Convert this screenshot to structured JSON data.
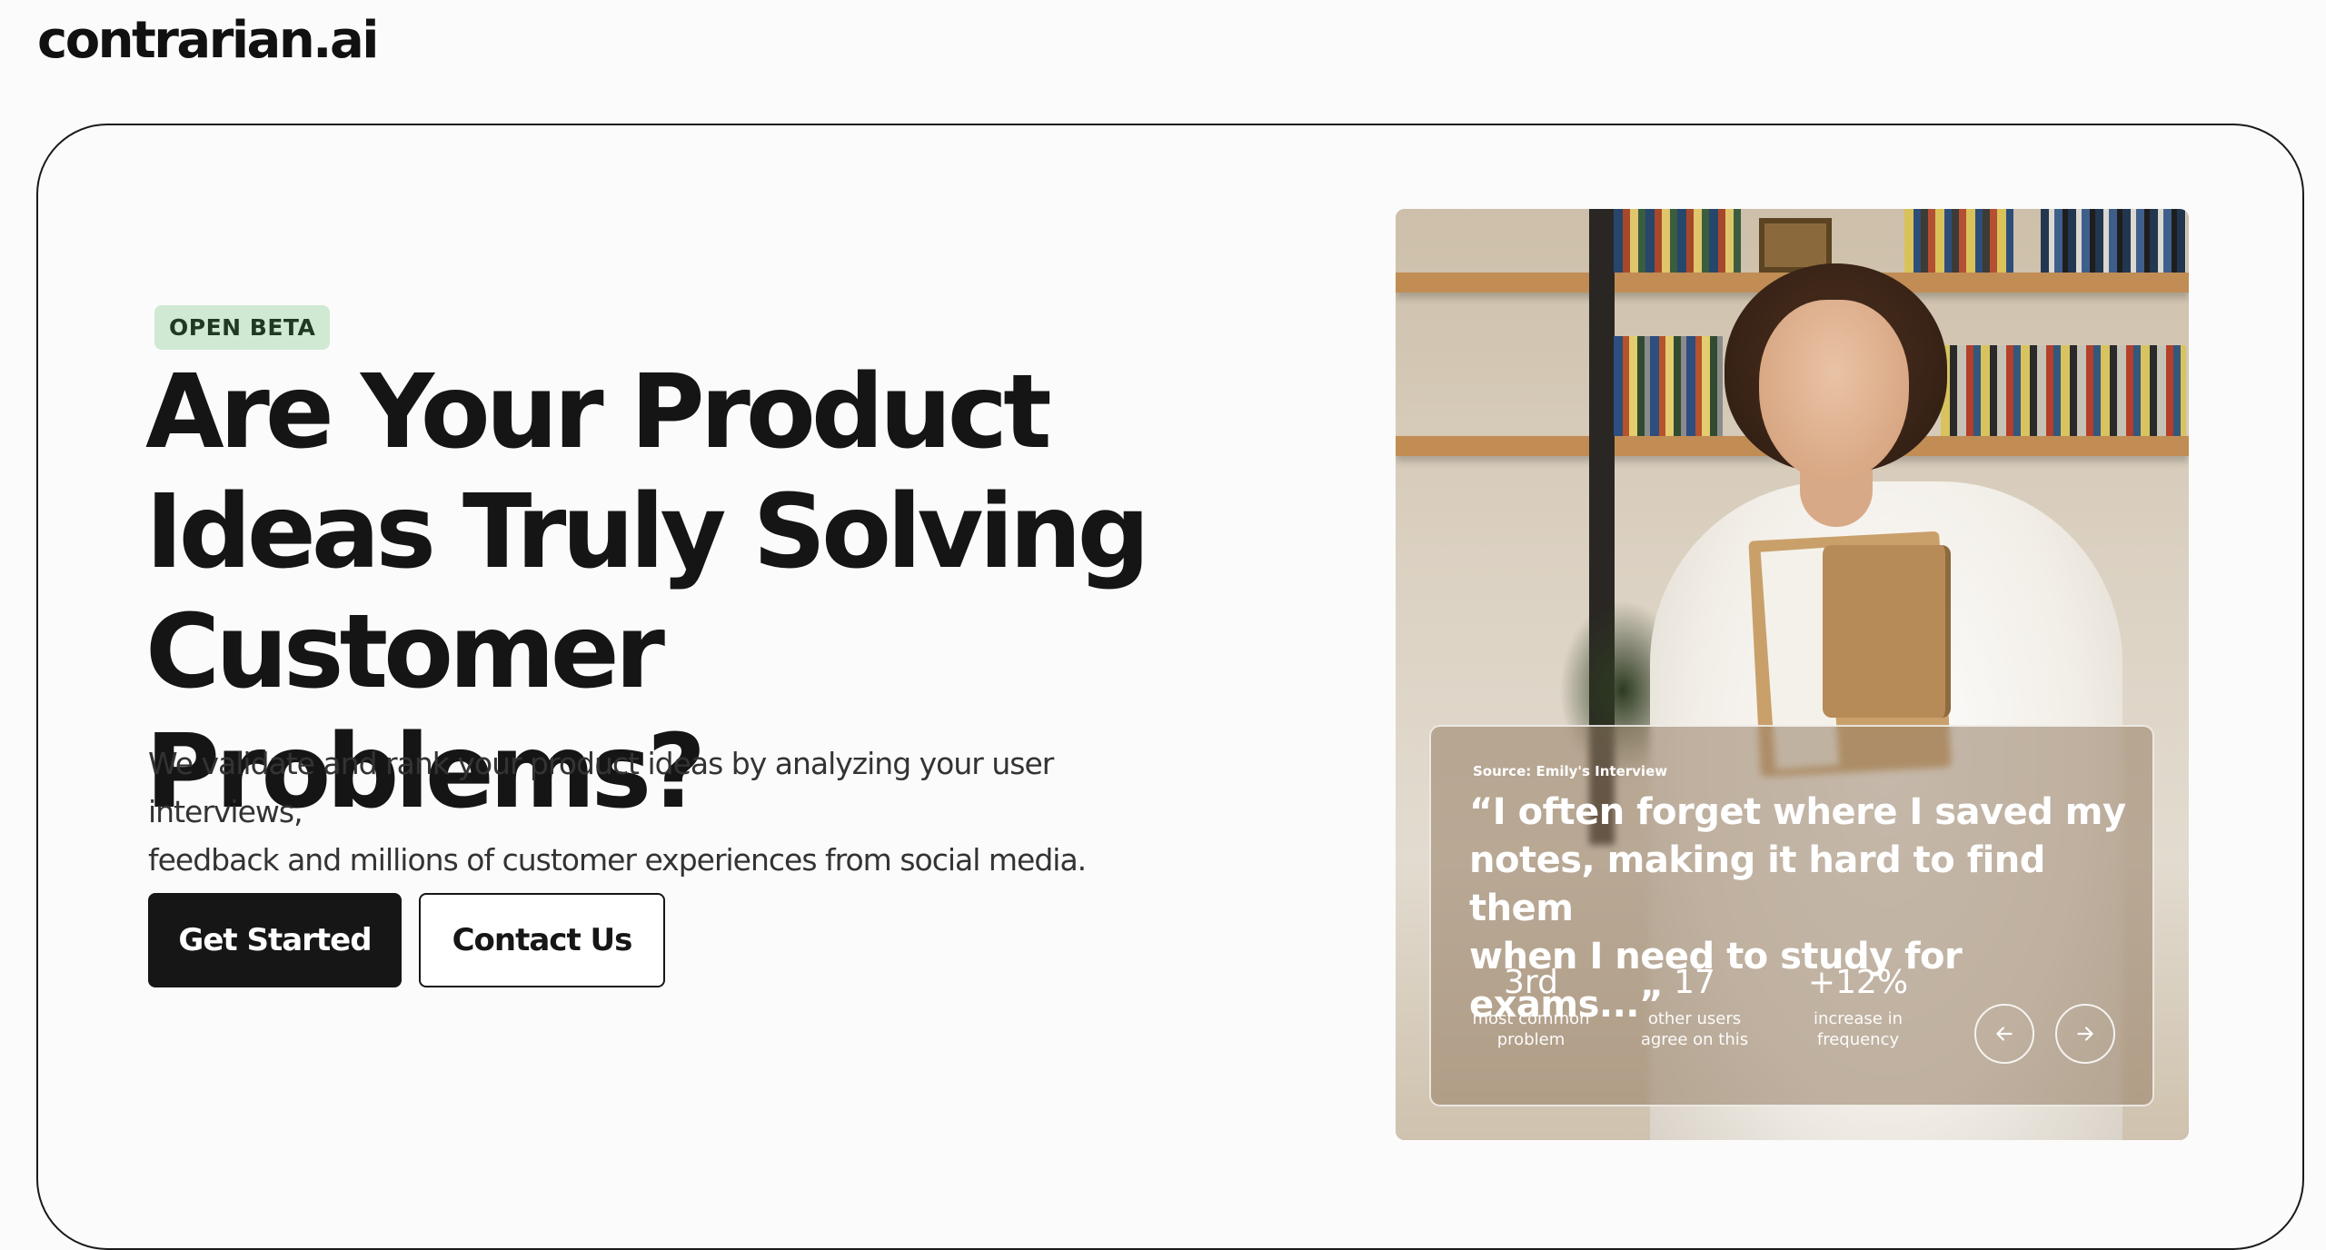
{
  "header": {
    "brand": "contrarian.ai"
  },
  "hero": {
    "badge": "OPEN BETA",
    "headline_lines": [
      "Are Your Product",
      "Ideas Truly Solving",
      "Customer Problems?"
    ],
    "subtitle_lines": [
      "We validate and rank your product ideas by analyzing your user interviews,",
      "feedback and millions of customer experiences from social media."
    ],
    "primary_button": "Get Started",
    "secondary_button": "Contact Us"
  },
  "testimonial": {
    "source": "Source: Emily's Interview",
    "quote_lines": [
      "“I often forget where I saved my",
      "notes, making it hard to find them",
      "when I need to study for exams...”"
    ],
    "stats": [
      {
        "value": "3rd",
        "label_lines": [
          "most common",
          "problem"
        ]
      },
      {
        "value": "17",
        "label_lines": [
          "other users",
          "agree on this"
        ]
      },
      {
        "value": "+12%",
        "label_lines": [
          "increase in",
          "frequency"
        ]
      }
    ],
    "prev_icon": "arrow-left-icon",
    "next_icon": "arrow-right-icon"
  },
  "colors": {
    "badge_bg": "#cfe9d3",
    "primary_button_bg": "#161616",
    "page_bg": "#fbfbfb"
  }
}
